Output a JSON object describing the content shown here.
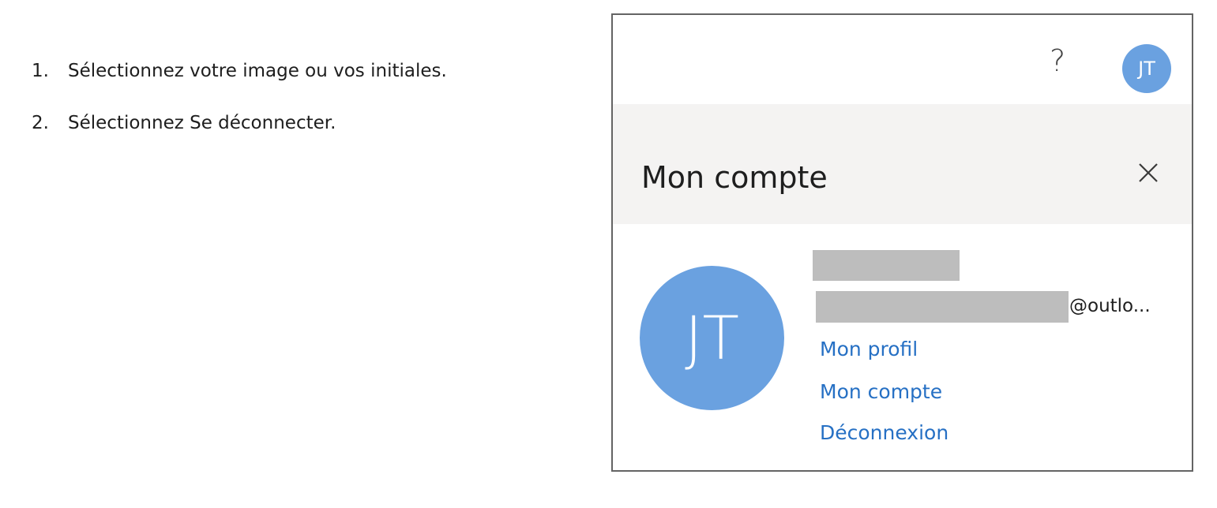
{
  "instructions": {
    "steps": [
      {
        "number": "1.",
        "text": "Sélectionnez votre image ou vos initiales."
      },
      {
        "number": "2.",
        "text": "Sélectionnez Se déconnecter."
      }
    ]
  },
  "panel": {
    "topbar": {
      "help_symbol": "?",
      "avatar_initials": "JT"
    },
    "header": {
      "title": "Mon compte",
      "close_icon": "close-icon"
    },
    "account": {
      "avatar_initials": "JT",
      "email_suffix": "@outlo...",
      "links": {
        "profile": "Mon profil",
        "account": "Mon compte",
        "logout": "Déconnexion"
      }
    }
  },
  "colors": {
    "avatar": "#6aa1e0",
    "link": "#2670c4",
    "header_bg": "#f4f3f2",
    "redaction": "#bdbdbd"
  }
}
